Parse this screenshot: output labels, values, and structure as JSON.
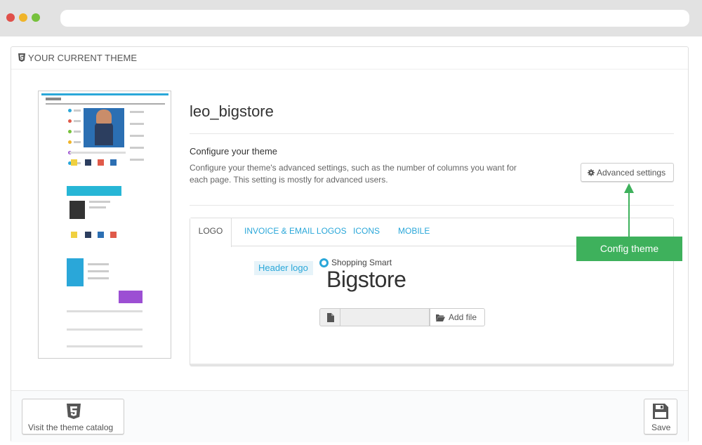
{
  "header": {
    "title": "YOUR CURRENT THEME"
  },
  "theme": {
    "name": "leo_bigstore",
    "configure_title": "Configure your theme",
    "configure_desc": "Configure your theme's advanced settings, such as the number of columns you want for each page. This setting is mostly for advanced users.",
    "advanced_label": "Advanced settings"
  },
  "tabs": [
    {
      "label": "LOGO",
      "active": true
    },
    {
      "label": "INVOICE & EMAIL LOGOS",
      "active": false
    },
    {
      "label": "ICONS",
      "active": false
    },
    {
      "label": "MOBILE",
      "active": false
    }
  ],
  "logo": {
    "header_label": "Header logo",
    "tagline": "Shopping Smart",
    "brand": "Bigstore",
    "add_file_label": "Add file"
  },
  "callout": {
    "label": "Config theme"
  },
  "footer": {
    "catalog_label": "Visit the theme catalog",
    "save_label": "Save"
  },
  "colors": {
    "accent": "#2aa7d9",
    "callout": "#3eb15c"
  },
  "icons": {
    "header": "html5-icon",
    "advanced": "gear-icon",
    "file": "file-icon",
    "add_file": "folder-open-icon",
    "catalog": "html5-icon",
    "save": "floppy-disk-icon"
  }
}
